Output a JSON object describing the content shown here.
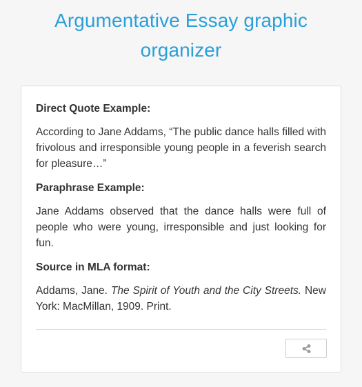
{
  "page": {
    "title": "Argumentative Essay graphic organizer"
  },
  "card": {
    "direct_quote": {
      "heading": "Direct Quote Example:",
      "text": "According to Jane Addams, “The public dance halls filled with frivolous and irresponsible young people in a feverish search for pleasure…”"
    },
    "paraphrase": {
      "heading": "Paraphrase Example:",
      "text": "Jane Addams observed that the dance halls were full of people who were young, irresponsible and just looking for fun."
    },
    "source": {
      "heading": "Source in MLA format:",
      "author": "Addams, Jane.",
      "title": "The Spirit of Youth and the City Streets.",
      "publication": "New York: MacMillan, 1909. Print."
    },
    "share_icon": "share-icon"
  },
  "colors": {
    "title": "#2a9fd8",
    "text": "#333333",
    "background": "#f6f6f6",
    "card": "#ffffff"
  }
}
